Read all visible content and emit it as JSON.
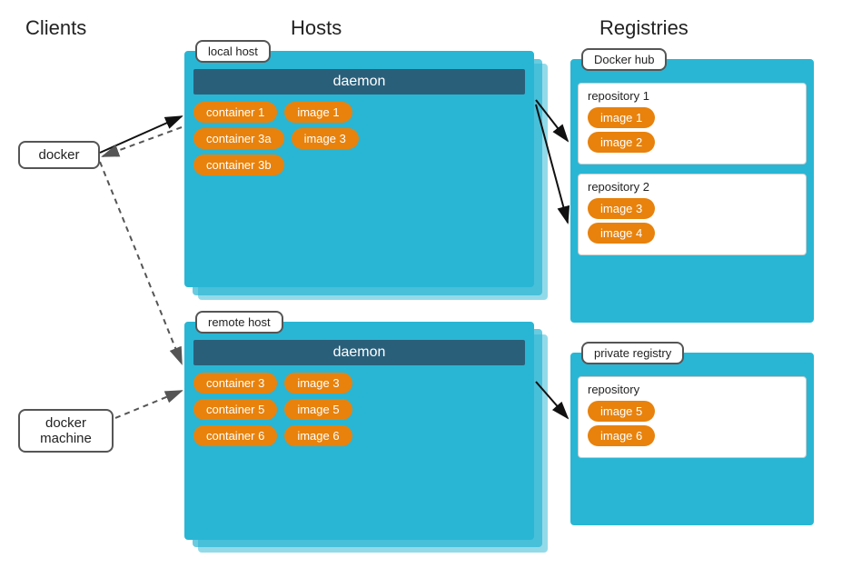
{
  "headers": {
    "clients": "Clients",
    "hosts": "Hosts",
    "registries": "Registries"
  },
  "clients": {
    "docker_label": "docker",
    "docker_machine_label": "docker machine"
  },
  "local_host": {
    "label": "local host",
    "daemon": "daemon",
    "rows": [
      {
        "container": "container 1",
        "image": "image 1"
      },
      {
        "container": "container 3a",
        "image": "image 3"
      },
      {
        "container": "container 3b",
        "image": null
      }
    ]
  },
  "remote_host": {
    "label": "remote host",
    "daemon": "daemon",
    "rows": [
      {
        "container": "container 3",
        "image": "image 3"
      },
      {
        "container": "container 5",
        "image": "image 5"
      },
      {
        "container": "container 6",
        "image": "image 6"
      }
    ]
  },
  "docker_hub": {
    "label": "Docker hub",
    "repo1": {
      "title": "repository 1",
      "images": [
        "image 1",
        "image 2"
      ]
    },
    "repo2": {
      "title": "repository 2",
      "images": [
        "image 3",
        "image 4"
      ]
    }
  },
  "private_registry": {
    "label": "private registry",
    "repo": {
      "title": "repository",
      "images": [
        "image 5",
        "image 6"
      ]
    }
  }
}
